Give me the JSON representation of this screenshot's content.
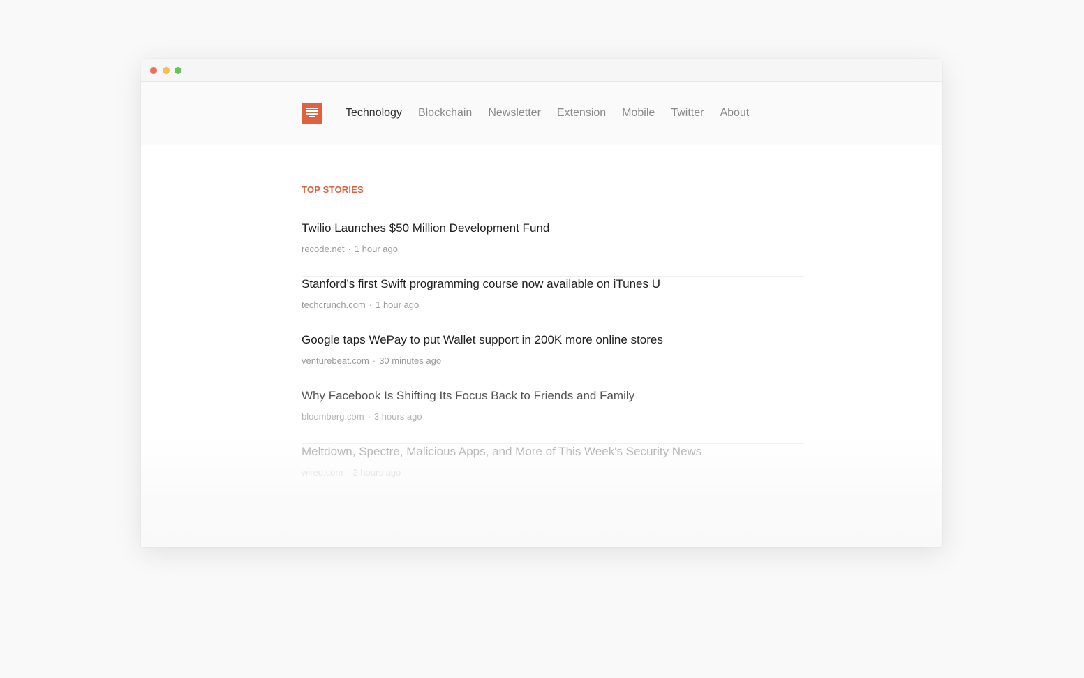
{
  "nav": {
    "items": [
      {
        "label": "Technology",
        "active": true
      },
      {
        "label": "Blockchain",
        "active": false
      },
      {
        "label": "Newsletter",
        "active": false
      },
      {
        "label": "Extension",
        "active": false
      },
      {
        "label": "Mobile",
        "active": false
      },
      {
        "label": "Twitter",
        "active": false
      },
      {
        "label": "About",
        "active": false
      }
    ]
  },
  "section": {
    "title": "TOP STORIES"
  },
  "stories": [
    {
      "title": "Twilio Launches $50 Million Development Fund",
      "source": "recode.net",
      "time": "1 hour ago"
    },
    {
      "title": "Stanford’s first Swift programming course now available on iTunes U",
      "source": "techcrunch.com",
      "time": "1 hour ago"
    },
    {
      "title": "Google taps WePay to put Wallet support in 200K more online stores",
      "source": "venturebeat.com",
      "time": "30 minutes ago"
    },
    {
      "title": "Why Facebook Is Shifting Its Focus Back to Friends and Family",
      "source": "bloomberg.com",
      "time": "3 hours ago"
    },
    {
      "title": "Meltdown, Spectre, Malicious Apps, and More of This Week's Security News",
      "source": "wired.com",
      "time": "2 hours ago"
    }
  ],
  "meta_separator": "·",
  "colors": {
    "accent": "#e0603f",
    "close": "#ee6a5f",
    "minimize": "#f5bf4f",
    "maximize": "#61c454"
  },
  "icons": {
    "logo": "newspaper-logo-icon"
  }
}
